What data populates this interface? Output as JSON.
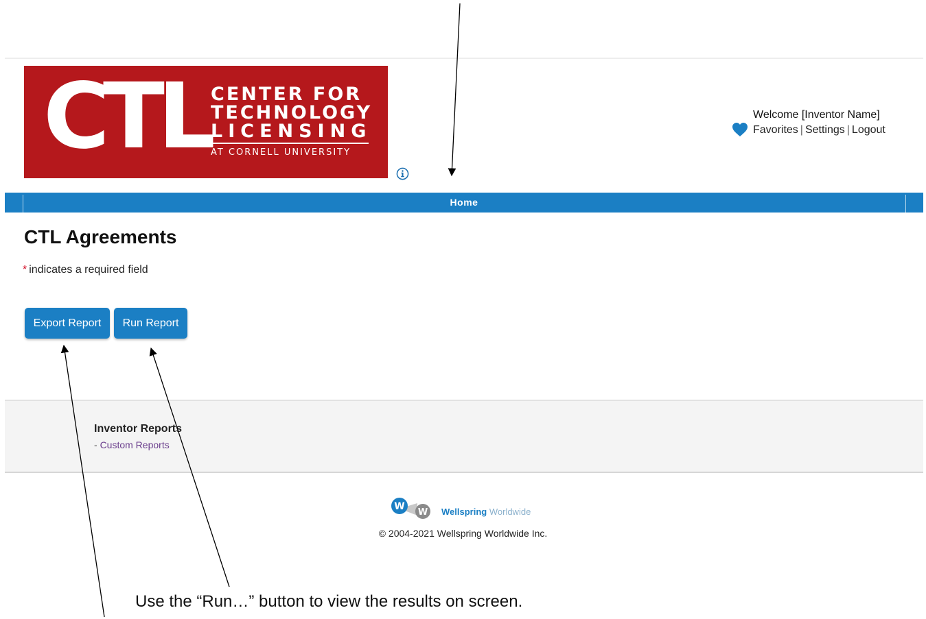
{
  "logo": {
    "mark": "CTL",
    "line1": "CENTER FOR",
    "line2": "TECHNOLOGY",
    "line3": "LICENSING",
    "subline": "AT CORNELL UNIVERSITY",
    "color": "#b5181c"
  },
  "header": {
    "welcome": "Welcome [Inventor Name]",
    "links": [
      "Favorites",
      "Settings",
      "Logout"
    ],
    "info_icon": "info-circle-icon",
    "favorites_icon": "heart-icon"
  },
  "nav": {
    "home": "Home",
    "color": "#1b7fc4"
  },
  "main": {
    "title": "CTL Agreements",
    "required_star": "*",
    "required_note": "indicates a required field",
    "buttons": {
      "export": "Export Report",
      "run": "Run Report"
    }
  },
  "footer": {
    "section_title": "Inventor Reports",
    "link_prefix": "- ",
    "link": "Custom Reports",
    "brand_bold": "Wellspring",
    "brand_light": "Worldwide",
    "copyright": "© 2004-2021 Wellspring Worldwide Inc."
  },
  "annotation": {
    "caption": "Use the “Run…” button to view the results on screen."
  }
}
